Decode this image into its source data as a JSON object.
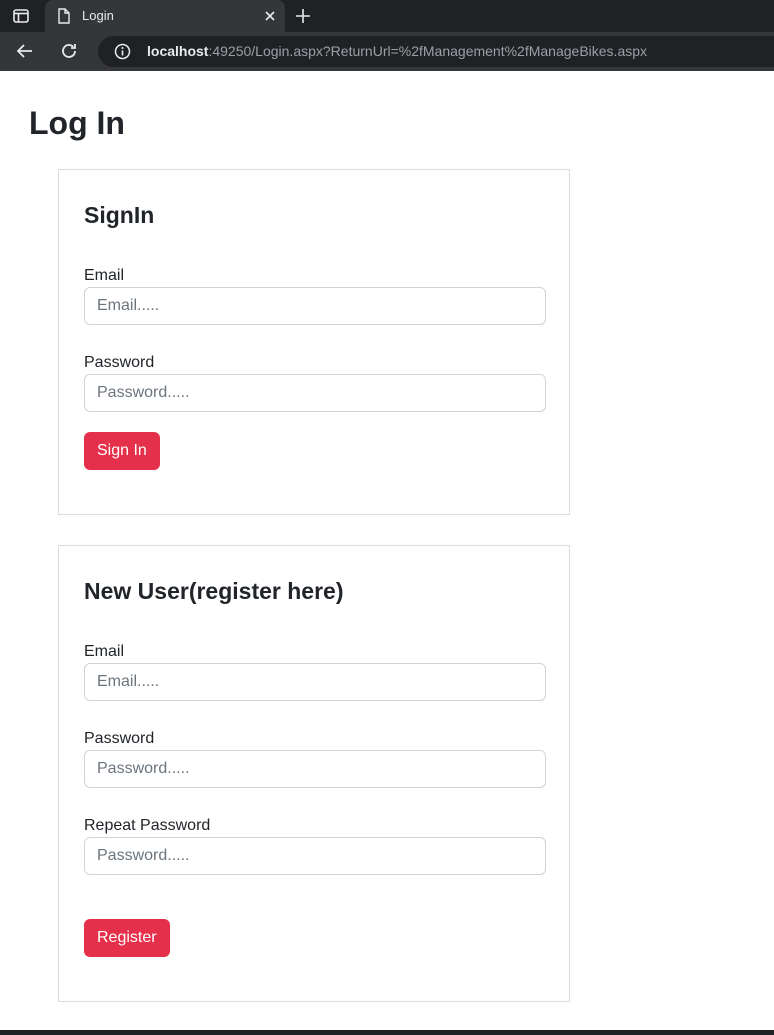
{
  "browser": {
    "tab_title": "Login",
    "url_host": "localhost",
    "url_rest": ":49250/Login.aspx?ReturnUrl=%2fManagement%2fManageBikes.aspx"
  },
  "page": {
    "title": "Log In"
  },
  "signin": {
    "heading": "SignIn",
    "email_label": "Email",
    "email_placeholder": "Email.....",
    "password_label": "Password",
    "password_placeholder": "Password.....",
    "button_label": "Sign In"
  },
  "register": {
    "heading": "New User(register here)",
    "email_label": "Email",
    "email_placeholder": "Email.....",
    "password_label": "Password",
    "password_placeholder": "Password.....",
    "repeat_label": "Repeat Password",
    "repeat_placeholder": "Password.....",
    "button_label": "Register"
  },
  "colors": {
    "accent": "#e4304a",
    "chrome_dark": "#202124",
    "chrome_tab": "#35363a"
  }
}
